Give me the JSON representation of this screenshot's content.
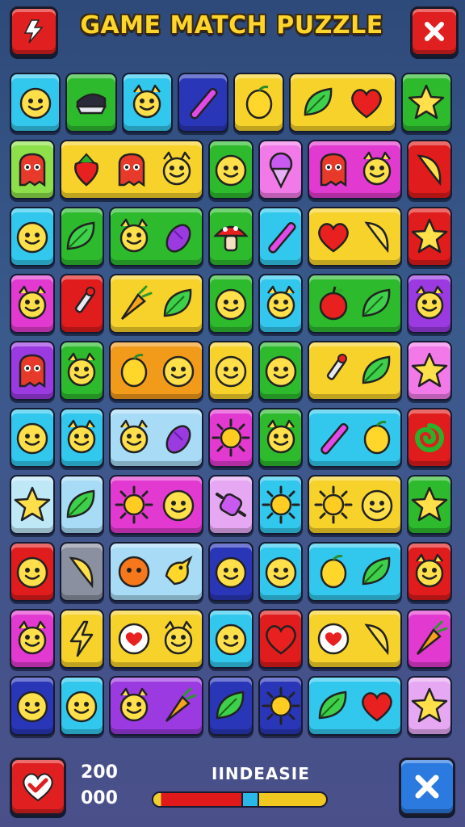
{
  "header": {
    "title": "GAME MATCH PUZZLE",
    "left_button_icon": "bolt-icon",
    "right_button_icon": "close-icon"
  },
  "footer": {
    "score_top": "200",
    "score_bottom": "000",
    "level_label": "IINDEASIE",
    "progress": 0.56,
    "left_button_icon": "heart-check-icon",
    "right_button_icon": "close-icon"
  },
  "colors": {
    "cyan": "#32c8ee",
    "green": "#2dba2d",
    "lime": "#8ee04a",
    "yellow": "#f6d22a",
    "magenta": "#e23ad0",
    "red": "#e01c1c",
    "navy": "#2a36b8",
    "purple": "#9a3ae0",
    "orange": "#f29a1a",
    "pink": "#f27ae8",
    "lightblue": "#a8dcf6",
    "gray": "#8a90a0",
    "lilac": "#e6a8f2",
    "palecyan": "#bfe8f6"
  },
  "board": [
    [
      {
        "c": "cyan",
        "i": [
          "face"
        ]
      },
      {
        "c": "green",
        "i": [
          "cap"
        ]
      },
      {
        "c": "cyan",
        "i": [
          "cat"
        ]
      },
      {
        "c": "navy",
        "i": [
          "wand"
        ]
      },
      {
        "c": "yellow",
        "i": [
          "lemon"
        ]
      },
      {
        "c": "yellow",
        "i": [
          "leaf",
          "heart"
        ]
      },
      {
        "c": "green",
        "i": [
          "star"
        ]
      }
    ],
    [
      {
        "c": "lime",
        "i": [
          "monster"
        ]
      },
      {
        "c": "yellow",
        "i": [
          "berry",
          "monster",
          "cat"
        ]
      },
      {
        "c": "green",
        "i": [
          "face"
        ]
      },
      {
        "c": "pink",
        "i": [
          "icecream"
        ]
      },
      {
        "c": "magenta",
        "i": [
          "monster",
          "cat"
        ]
      },
      {
        "c": "red",
        "i": [
          "banana"
        ]
      }
    ],
    [
      {
        "c": "cyan",
        "i": [
          "face"
        ]
      },
      {
        "c": "green",
        "i": [
          "leaf"
        ]
      },
      {
        "c": "green",
        "i": [
          "cat",
          "eggplant"
        ]
      },
      {
        "c": "green",
        "i": [
          "mushroom"
        ]
      },
      {
        "c": "cyan",
        "i": [
          "wand"
        ]
      },
      {
        "c": "yellow",
        "i": [
          "heart",
          "banana"
        ]
      },
      {
        "c": "red",
        "i": [
          "star"
        ]
      }
    ],
    [
      {
        "c": "magenta",
        "i": [
          "cat"
        ]
      },
      {
        "c": "red",
        "i": [
          "dropper"
        ]
      },
      {
        "c": "yellow",
        "i": [
          "carrot",
          "leaf"
        ]
      },
      {
        "c": "green",
        "i": [
          "face"
        ]
      },
      {
        "c": "cyan",
        "i": [
          "cat"
        ]
      },
      {
        "c": "green",
        "i": [
          "apple",
          "leaf"
        ]
      },
      {
        "c": "purple",
        "i": [
          "cat"
        ]
      }
    ],
    [
      {
        "c": "purple",
        "i": [
          "monster"
        ]
      },
      {
        "c": "green",
        "i": [
          "cat"
        ]
      },
      {
        "c": "orange",
        "i": [
          "lemon",
          "face"
        ]
      },
      {
        "c": "yellow",
        "i": [
          "face"
        ]
      },
      {
        "c": "green",
        "i": [
          "face"
        ]
      },
      {
        "c": "yellow",
        "i": [
          "dropper",
          "leaf"
        ]
      },
      {
        "c": "pink",
        "i": [
          "star"
        ]
      }
    ],
    [
      {
        "c": "cyan",
        "i": [
          "face"
        ]
      },
      {
        "c": "cyan",
        "i": [
          "cat"
        ]
      },
      {
        "c": "lightblue",
        "i": [
          "cat",
          "eggplant"
        ]
      },
      {
        "c": "magenta",
        "i": [
          "sun"
        ]
      },
      {
        "c": "green",
        "i": [
          "cat"
        ]
      },
      {
        "c": "cyan",
        "i": [
          "wand",
          "lemon"
        ]
      },
      {
        "c": "red",
        "i": [
          "swirl"
        ]
      }
    ],
    [
      {
        "c": "palecyan",
        "i": [
          "star"
        ]
      },
      {
        "c": "lightblue",
        "i": [
          "leaf"
        ]
      },
      {
        "c": "magenta",
        "i": [
          "sun",
          "face"
        ]
      },
      {
        "c": "lilac",
        "i": [
          "candy"
        ]
      },
      {
        "c": "cyan",
        "i": [
          "sun"
        ]
      },
      {
        "c": "yellow",
        "i": [
          "sun",
          "face"
        ]
      },
      {
        "c": "green",
        "i": [
          "star"
        ]
      }
    ],
    [
      {
        "c": "red",
        "i": [
          "face"
        ]
      },
      {
        "c": "gray",
        "i": [
          "banana"
        ]
      },
      {
        "c": "lightblue",
        "i": [
          "orangeball",
          "bird"
        ]
      },
      {
        "c": "navy",
        "i": [
          "face"
        ]
      },
      {
        "c": "cyan",
        "i": [
          "face"
        ]
      },
      {
        "c": "cyan",
        "i": [
          "lemon",
          "leaf"
        ]
      },
      {
        "c": "red",
        "i": [
          "cat"
        ]
      }
    ],
    [
      {
        "c": "magenta",
        "i": [
          "cat"
        ]
      },
      {
        "c": "yellow",
        "i": [
          "bolt"
        ]
      },
      {
        "c": "yellow",
        "i": [
          "heartbubble",
          "cat"
        ]
      },
      {
        "c": "cyan",
        "i": [
          "face"
        ]
      },
      {
        "c": "red",
        "i": [
          "heart"
        ]
      },
      {
        "c": "yellow",
        "i": [
          "heartbubble",
          "banana"
        ]
      },
      {
        "c": "magenta",
        "i": [
          "carrot"
        ]
      }
    ],
    [
      {
        "c": "navy",
        "i": [
          "face"
        ]
      },
      {
        "c": "cyan",
        "i": [
          "face"
        ]
      },
      {
        "c": "purple",
        "i": [
          "cat",
          "carrot"
        ]
      },
      {
        "c": "navy",
        "i": [
          "leaf"
        ]
      },
      {
        "c": "navy",
        "i": [
          "sun"
        ]
      },
      {
        "c": "cyan",
        "i": [
          "leaf",
          "heart"
        ]
      },
      {
        "c": "lilac",
        "i": [
          "star"
        ]
      }
    ]
  ]
}
